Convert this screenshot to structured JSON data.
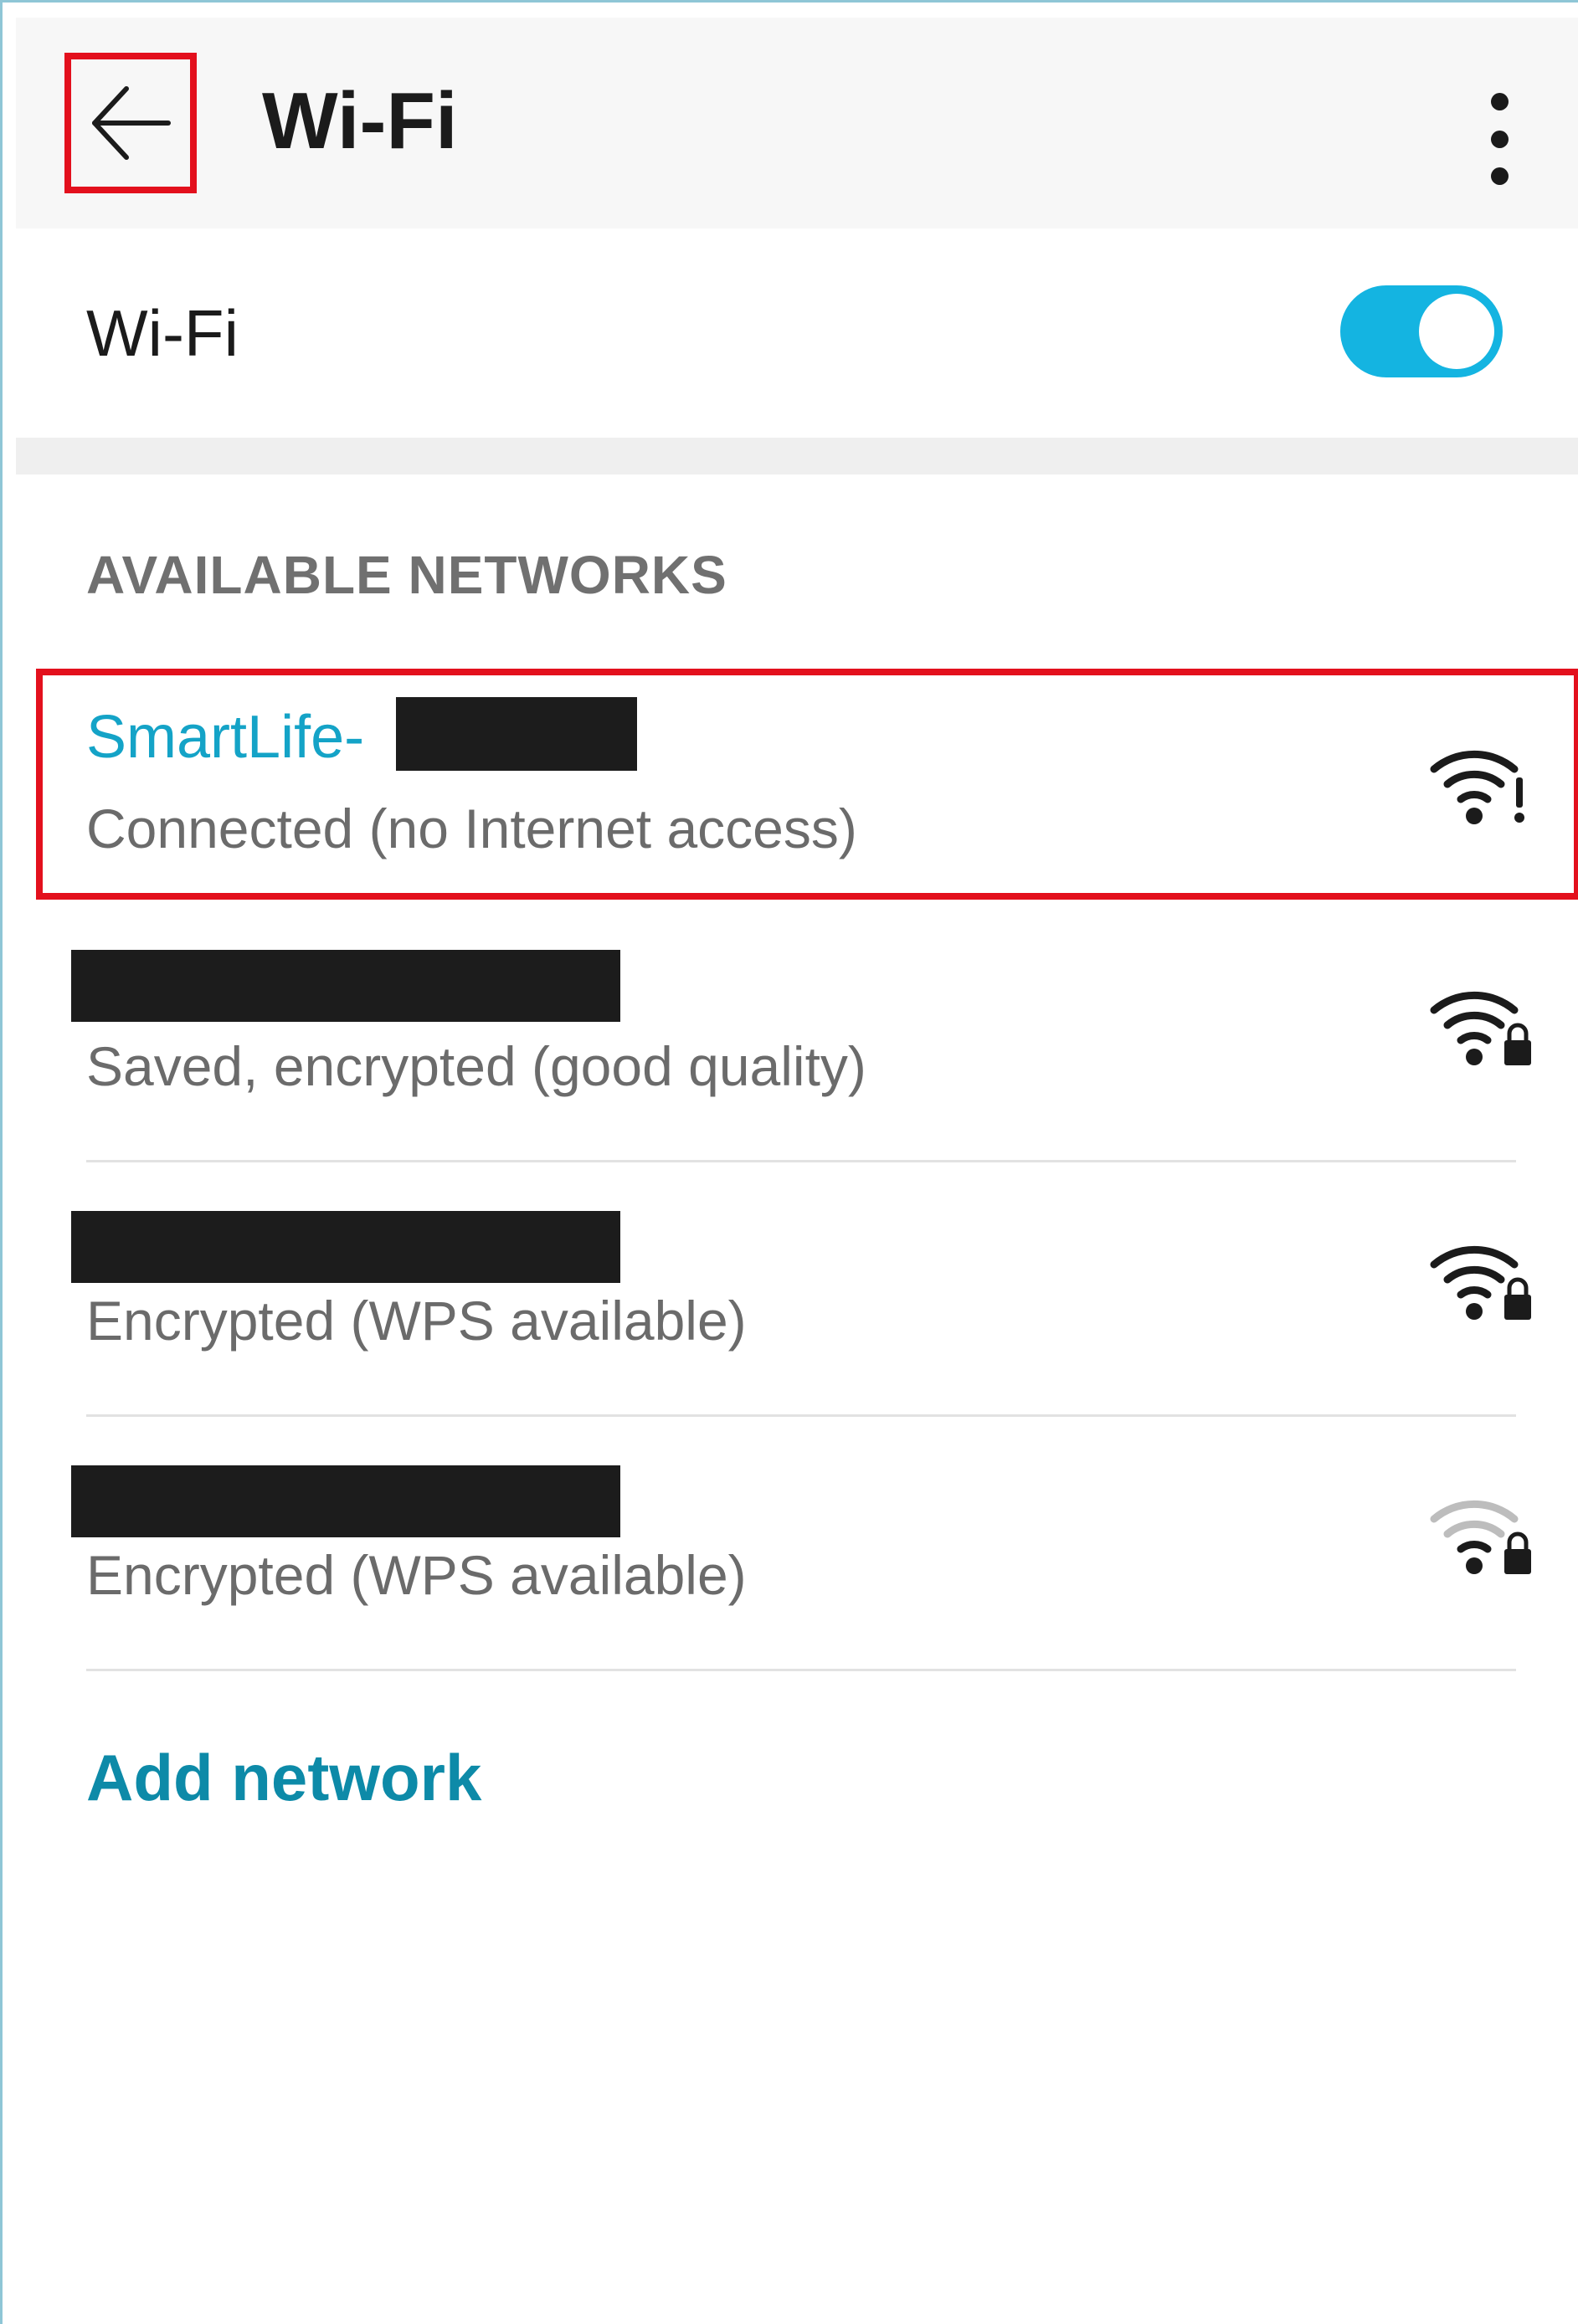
{
  "header": {
    "title": "Wi-Fi",
    "back_icon": "arrow-left-icon",
    "more_icon": "more-vertical-icon"
  },
  "wifi_toggle": {
    "label": "Wi-Fi",
    "state": "on",
    "accent_color": "#14b4e1"
  },
  "available_networks": {
    "section_label": "AVAILABLE NETWORKS",
    "networks": [
      {
        "ssid": "SmartLife-",
        "ssid_redacted": true,
        "status": "Connected (no Internet access)",
        "signal_icon": "wifi-alert-icon",
        "connected": true,
        "ssid_color": "#14a3c7"
      },
      {
        "ssid": "",
        "ssid_redacted": true,
        "status": "Saved, encrypted (good quality)",
        "signal_icon": "wifi-lock-icon"
      },
      {
        "ssid": "",
        "ssid_redacted": true,
        "status": "Encrypted (WPS available)",
        "signal_icon": "wifi-lock-icon"
      },
      {
        "ssid": "",
        "ssid_redacted": true,
        "status": "Encrypted (WPS available)",
        "signal_icon": "wifi-lock-weak-icon"
      }
    ]
  },
  "add_network": {
    "label": "Add network",
    "color": "#0d8aa8"
  },
  "highlight_color": "#e3101d"
}
